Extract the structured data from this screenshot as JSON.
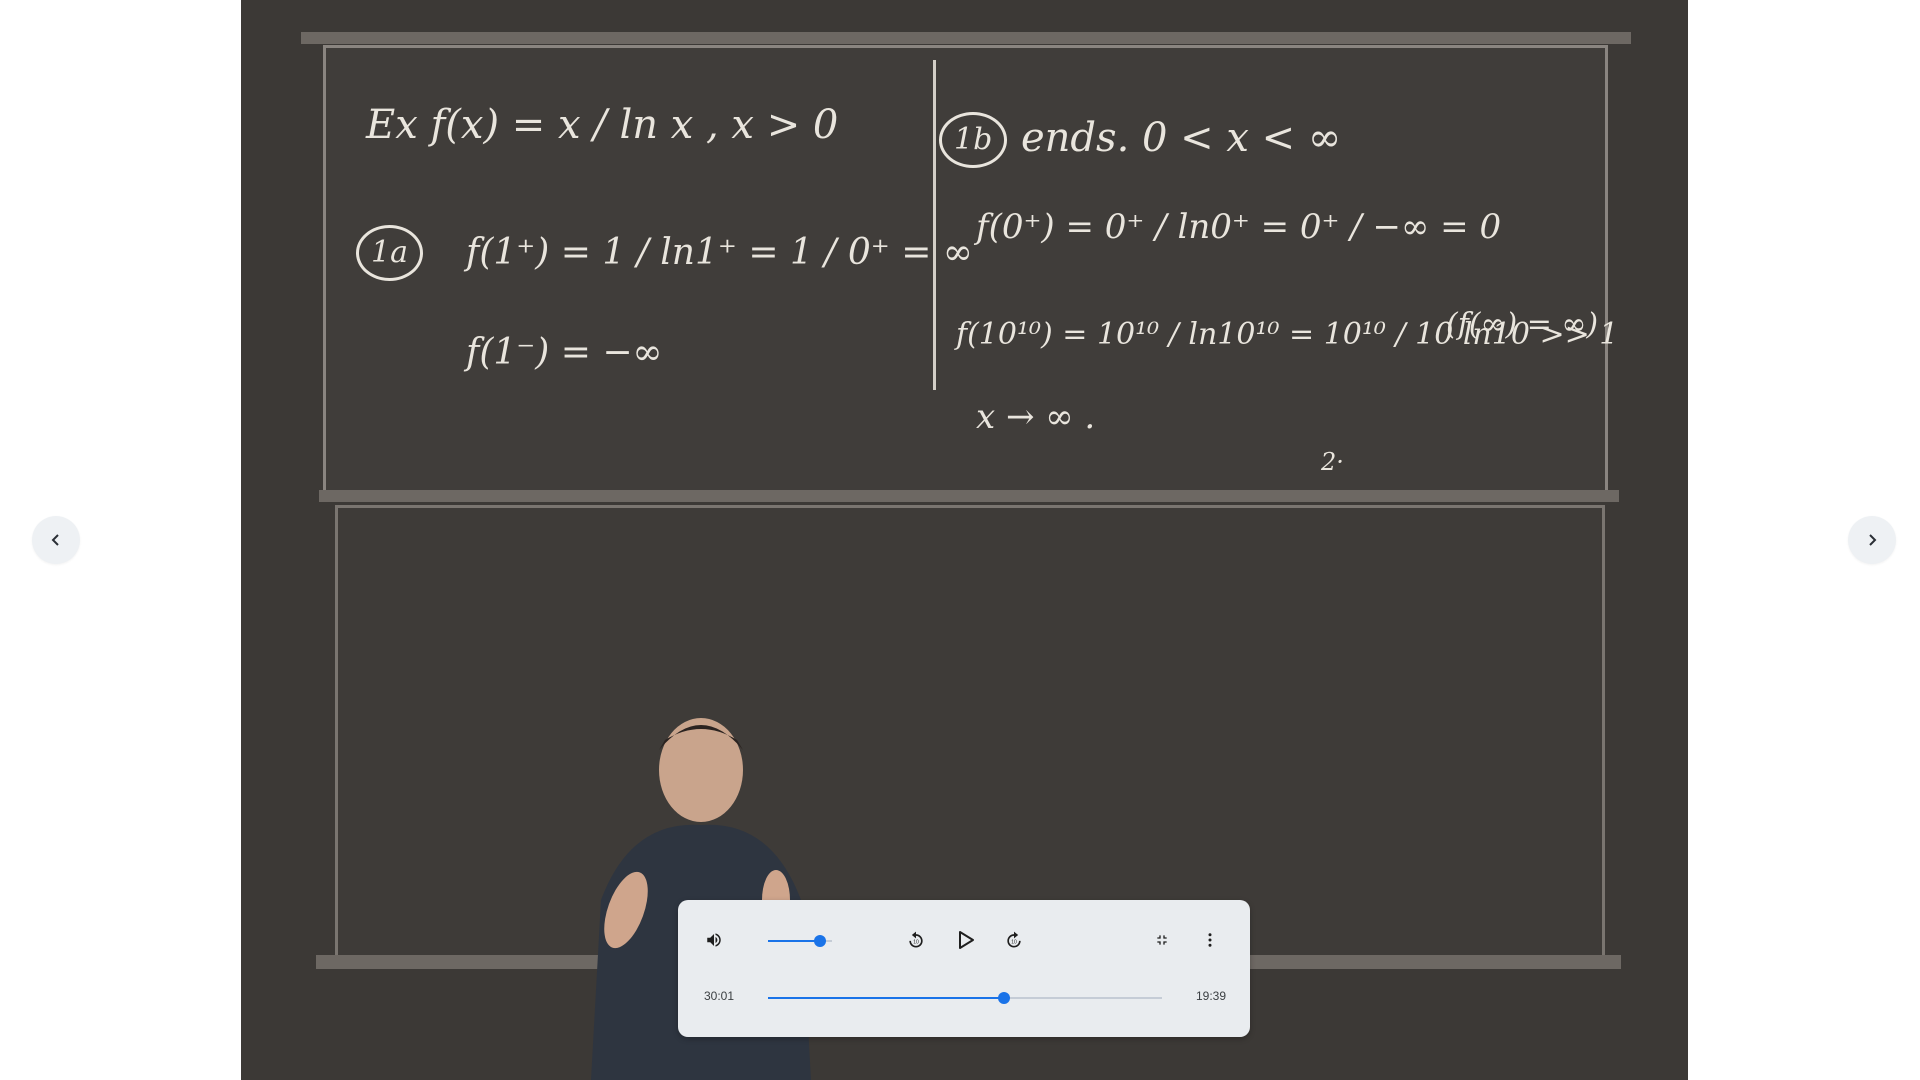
{
  "viewer": {
    "prev_label": "‹",
    "next_label": "›"
  },
  "video": {
    "board_text": {
      "left_title": "Ex  f(x) = x / ln x ,  x > 0",
      "step_1a": "1a",
      "line_1a": "f(1⁺) = 1 / ln1⁺ = 1 / 0⁺ = ∞",
      "line_1a_minus": "f(1⁻) = −∞",
      "step_1b": "1b",
      "ends": "ends.   0 < x < ∞",
      "line_0plus": "f(0⁺) = 0⁺ / ln0⁺ = 0⁺ / −∞ = 0",
      "line_10": "f(10¹⁰) = 10¹⁰ / ln10¹⁰ = 10¹⁰ / 10 ln10 >> 1",
      "line_finf": "(f(∞) = ∞)",
      "x_to_inf": "x → ∞ .",
      "approx": "2·"
    }
  },
  "player": {
    "current_time": "30:01",
    "duration": "19:39",
    "volume_fraction": 0.82,
    "progress_fraction": 0.6
  },
  "colors": {
    "accent": "#1a73e8",
    "panel": "#e9ecef"
  },
  "icons": {
    "volume": "volume-icon",
    "rewind": "rewind-10-icon",
    "play": "play-icon",
    "forward": "forward-10-icon",
    "exit_fullscreen": "exit-fullscreen-icon",
    "more": "more-vert-icon"
  }
}
